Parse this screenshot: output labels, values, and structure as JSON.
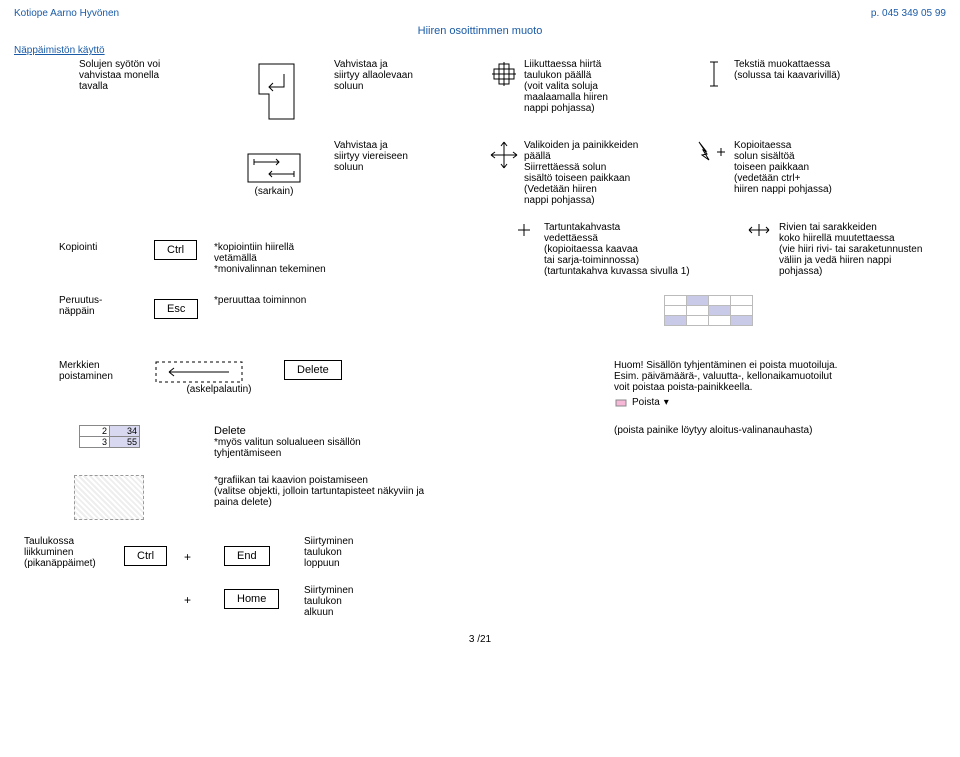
{
  "header": {
    "left": "Kotiope Aarno Hyvönen",
    "right": "p. 045 349 05 99",
    "title": "Hiiren osoittimmen muoto"
  },
  "keyboard_section": "Näppäimistön käyttö",
  "row1": {
    "c1a": "Solujen syötön voi",
    "c1b": "vahvistaa monella",
    "c1c": "tavalla",
    "c3a": "Vahvistaa ja",
    "c3b": "siirtyy allaolevaan",
    "c3c": "soluun",
    "c5a": "Liikuttaessa hiirtä",
    "c5b": "taulukon päällä",
    "c5c": "(voit valita soluja",
    "c5d": "maalaamalla hiiren",
    "c5e": "nappi pohjassa)",
    "c7a": "Tekstiä muokattaessa",
    "c7b": "(solussa tai kaavarivillä)"
  },
  "row2": {
    "c2": "(sarkain)",
    "c3a": "Vahvistaa ja",
    "c3b": "siirtyy viereiseen",
    "c3c": "soluun",
    "c5a": "Valikoiden ja painikkeiden",
    "c5b": "päällä",
    "c5c": "Siirrettäessä solun",
    "c5d": "sisältö toiseen paikkaan",
    "c5e": "(Vedetään hiiren",
    "c5f": "nappi pohjassa)",
    "c7a": "Kopioitaessa",
    "c7b": "solun sisältöä",
    "c7c": "toiseen paikkaan",
    "c7d": "(vedetään ctrl+",
    "c7e": "hiiren nappi pohjassa)"
  },
  "row3": {
    "c1": "Kopiointi",
    "key": "Ctrl",
    "c3a": "*kopiointiin hiirellä",
    "c3b": "vetämällä",
    "c3c": "*monivalinnan tekeminen",
    "c5a": "Tartuntakahvasta",
    "c5b": "vedettäessä",
    "c5c": "(kopioitaessa kaavaa",
    "c5d": "tai sarja-toiminnossa)",
    "c5e": "(tartuntakahva kuvassa sivulla 1)",
    "c7a": "Rivien tai sarakkeiden",
    "c7b": "koko hiirellä muutettaessa",
    "c7c": "(vie hiiri rivi- tai saraketunnusten",
    "c7d": "väliin ja vedä hiiren nappi",
    "c7e": "pohjassa)"
  },
  "row4": {
    "c1a": "Peruutus-",
    "c1b": "näppäin",
    "key": "Esc",
    "c3": "*peruuttaa toiminnon"
  },
  "row5": {
    "c1a": "Merkkien",
    "c1b": "poistaminen",
    "c2": "(askelpalautin)",
    "key": "Delete",
    "c7a": "Huom!  Sisällön tyhjentäminen ei poista muotoiluja.",
    "c7b": "Esim. päivämäärä-, valuutta-, kellonaikamuotoilut",
    "c7c": "voit poistaa poista-painikkeella.",
    "poista": "Poista"
  },
  "row6": {
    "table_a1": "2",
    "table_b1": "34",
    "table_a2": "3",
    "table_b2": "55",
    "key": "Delete",
    "c3a": "*myös valitun solualueen sisällön",
    "c3b": "tyhjentämiseen",
    "c7": "(poista painike löytyy aloitus-valinanauhasta)"
  },
  "row7": {
    "c3a": "*grafiikan tai kaavion poistamiseen",
    "c3b": "(valitse objekti, jolloin tartuntapisteet näkyviin ja",
    "c3c": "paina delete)"
  },
  "row8": {
    "c1a": "Taulukossa",
    "c1b": "liikkuminen",
    "c1c": "(pikanäppäimet)",
    "key1": "Ctrl",
    "plus": "+",
    "key2": "End",
    "c5a": "Siirtyminen",
    "c5b": "taulukon",
    "c5c": "loppuun"
  },
  "row9": {
    "plus": "+",
    "key": "Home",
    "c5a": "Siirtyminen",
    "c5b": "taulukon",
    "c5c": "alkuun"
  },
  "footer": "3 /21"
}
